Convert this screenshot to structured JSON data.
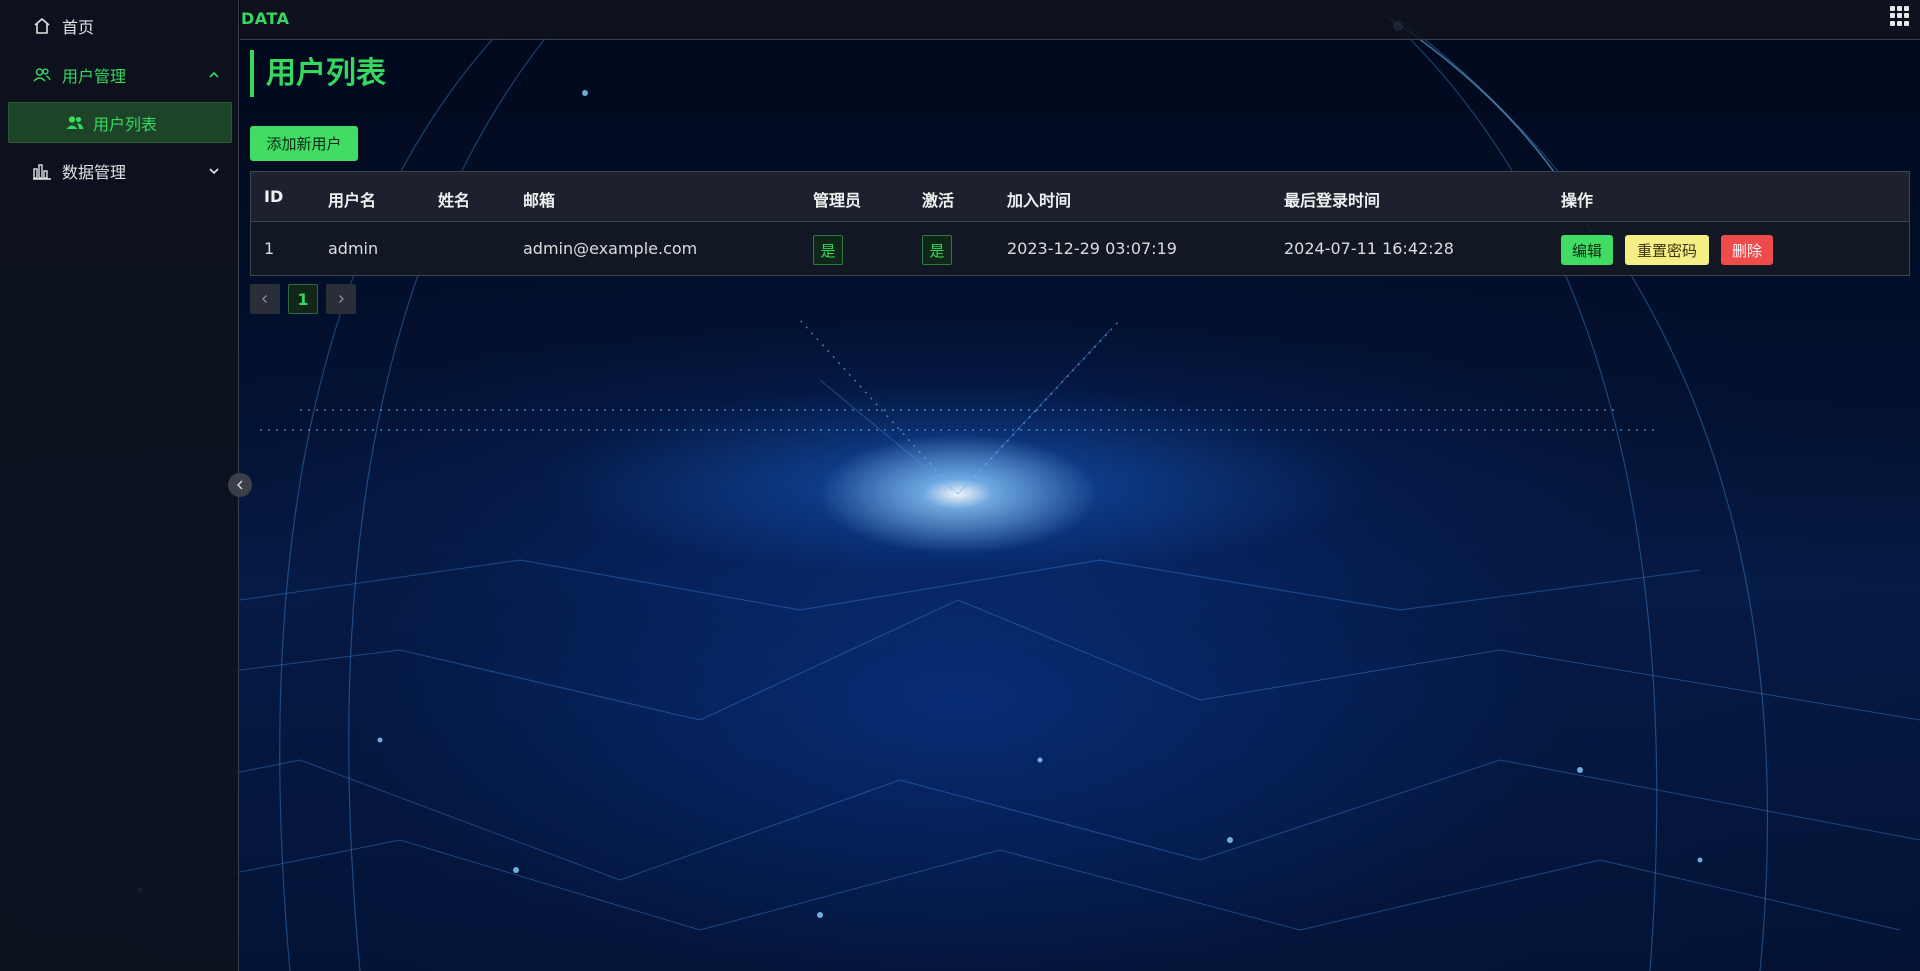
{
  "header": {
    "brand": "DATA",
    "apps_icon": "grid-apps-icon"
  },
  "sidebar": {
    "items": [
      {
        "label": "首页",
        "icon": "home-icon"
      },
      {
        "label": "用户管理",
        "icon": "users-icon",
        "expanded": true
      },
      {
        "label": "用户列表",
        "icon": "user-group-icon",
        "active": true
      },
      {
        "label": "数据管理",
        "icon": "chart-bar-icon",
        "expanded": false
      }
    ]
  },
  "main": {
    "title": "用户列表",
    "add_button": "添加新用户",
    "table": {
      "columns": [
        "ID",
        "用户名",
        "姓名",
        "邮箱",
        "管理员",
        "激活",
        "加入时间",
        "最后登录时间",
        "操作"
      ],
      "rows": [
        {
          "id": "1",
          "username": "admin",
          "name": "",
          "email": "admin@example.com",
          "is_admin": "是",
          "is_active": "是",
          "joined": "2023-12-29 03:07:19",
          "last_login": "2024-07-11 16:42:28",
          "actions": {
            "edit": "编辑",
            "reset": "重置密码",
            "delete": "删除"
          }
        }
      ]
    },
    "pagination": {
      "current": "1"
    }
  },
  "colors": {
    "accent": "#36d85f",
    "warn": "#f5ee84",
    "danger": "#f04b4b"
  }
}
